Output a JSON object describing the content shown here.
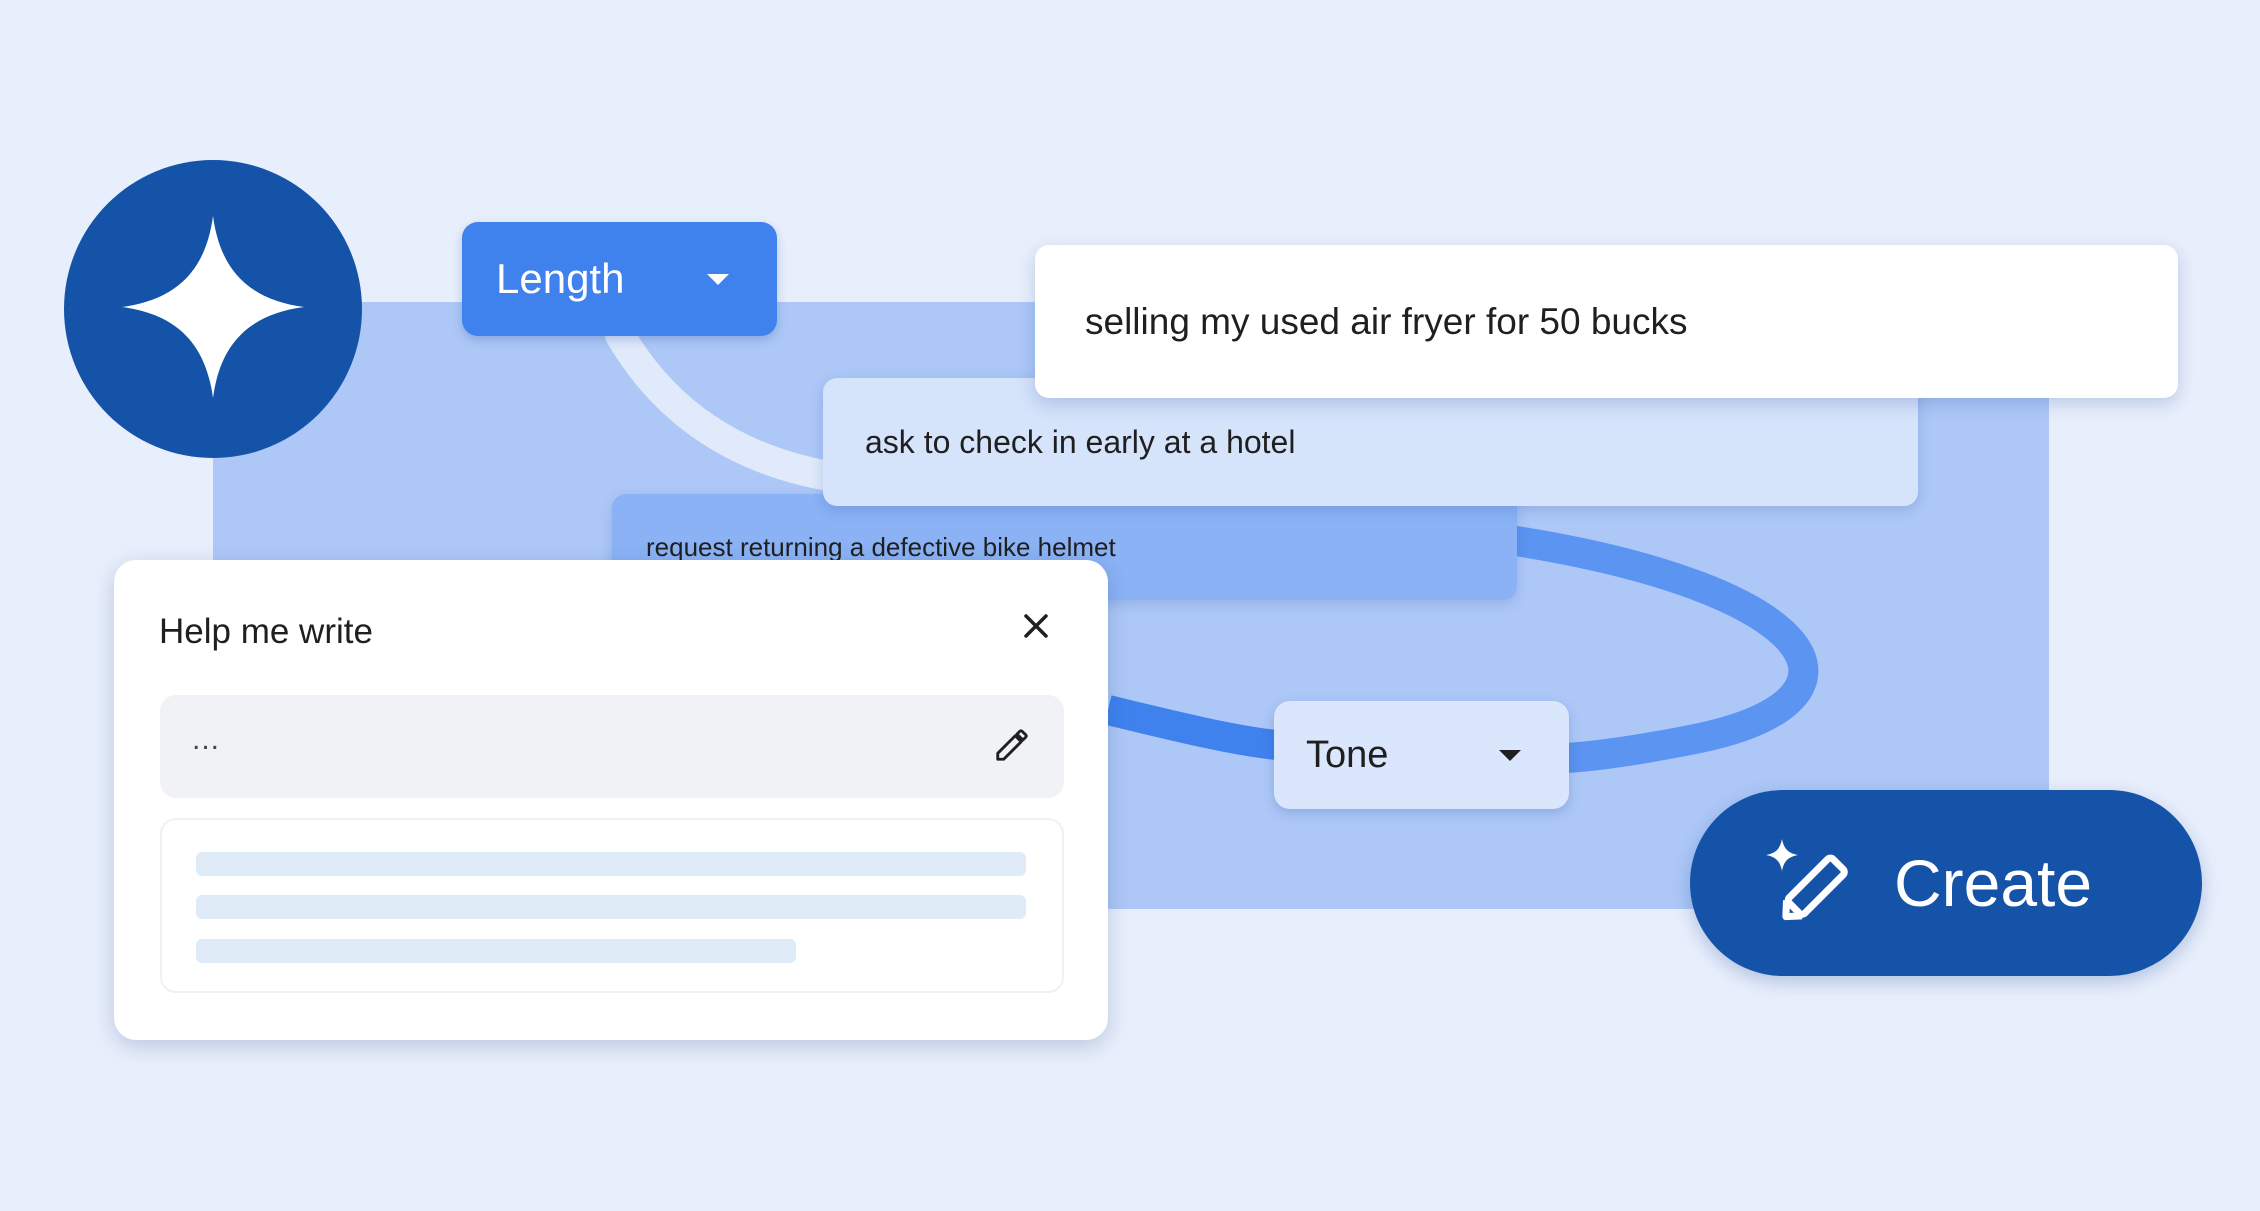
{
  "colors": {
    "page_background": "#e8effc",
    "panel_background": "#adc8f7",
    "brand_dark_blue": "#1553a8",
    "accent_blue": "#3f82ee"
  },
  "logo": {
    "icon": "sparkle-icon"
  },
  "length_dropdown": {
    "label": "Length",
    "icon": "arrow-drop-down-icon"
  },
  "tone_dropdown": {
    "label": "Tone",
    "icon": "arrow-drop-down-icon"
  },
  "prompts": [
    "selling my used air fryer for 50 bucks",
    "ask to check in early at a hotel",
    "request returning a defective bike helmet"
  ],
  "help_card": {
    "title": "Help me write",
    "close_icon": "close-icon",
    "input_value": "...",
    "edit_icon": "pencil-icon"
  },
  "create_button": {
    "label": "Create",
    "icon": "magic-pen-icon"
  }
}
